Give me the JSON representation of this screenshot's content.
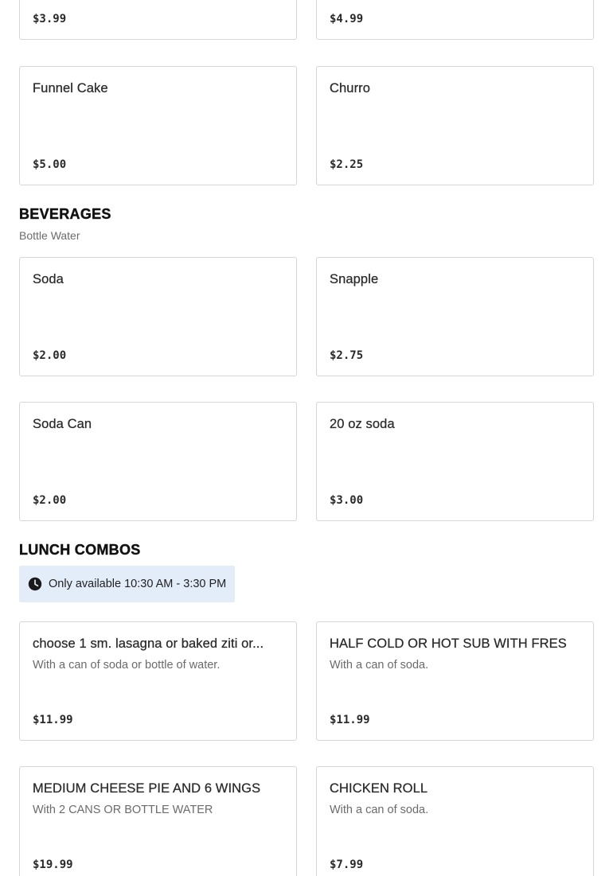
{
  "top_row": [
    {
      "price": "$3.99"
    },
    {
      "price": "$4.99"
    }
  ],
  "desserts": [
    {
      "name": "Funnel Cake",
      "price": "$5.00"
    },
    {
      "name": "Churro",
      "price": "$2.25"
    }
  ],
  "beverages": {
    "title": "BEVERAGES",
    "subtitle": "Bottle Water",
    "items": [
      {
        "name": "Soda",
        "price": "$2.00"
      },
      {
        "name": "Snapple",
        "price": "$2.75"
      },
      {
        "name": "Soda Can",
        "price": "$2.00"
      },
      {
        "name": "20 oz soda",
        "price": "$3.00"
      }
    ]
  },
  "lunch_combos": {
    "title": "LUNCH COMBOS",
    "availability": {
      "icon": "clock-icon",
      "text": "Only available 10:30 AM - 3:30 PM"
    },
    "items": [
      {
        "name": "choose 1 sm. lasagna or baked ziti or...",
        "description": "With a can of soda or bottle of water.",
        "price": "$11.99"
      },
      {
        "name": "HALF COLD OR HOT SUB WITH FRES",
        "description": "With a can of soda.",
        "price": "$11.99"
      },
      {
        "name": "MEDIUM CHEESE PIE AND 6 WINGS",
        "description": "With 2 CANS OR BOTTLE WATER",
        "price": "$19.99"
      },
      {
        "name": "CHICKEN ROLL",
        "description": "With a can of soda.",
        "price": "$7.99"
      }
    ]
  },
  "colors": {
    "notice_bg": "#e3edf9",
    "card_border": "#d6d6d6",
    "muted_text": "#6b6b6b"
  }
}
